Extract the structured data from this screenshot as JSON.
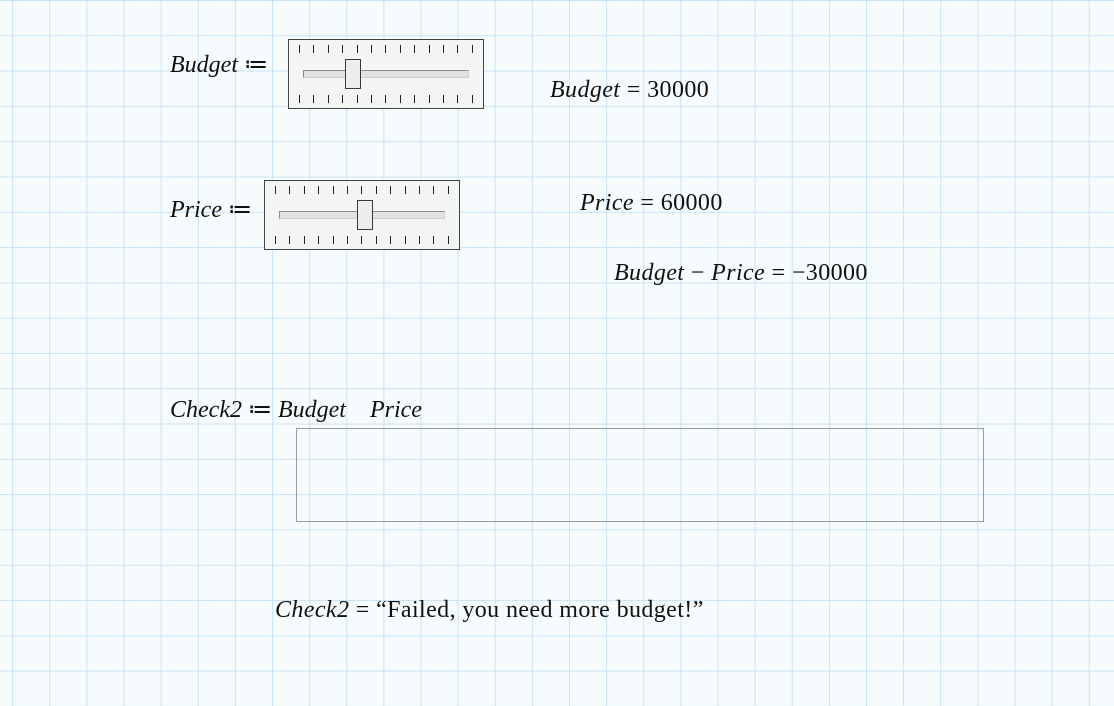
{
  "budget": {
    "name": "Budget",
    "assign_op": "≔",
    "value": 30000,
    "slider_fraction": 0.3
  },
  "price": {
    "name": "Price",
    "assign_op": "≔",
    "value": 60000,
    "slider_fraction": 0.52
  },
  "difference": {
    "lhs_a": "Budget",
    "lhs_b": "Price",
    "eq": "=",
    "value": -30000
  },
  "check2": {
    "name": "Check2",
    "assign_op": "≔",
    "expr_a": "Budget",
    "expr_b": "Price",
    "result": "“Failed, you need more budget!”"
  },
  "slider_ticks": 13
}
